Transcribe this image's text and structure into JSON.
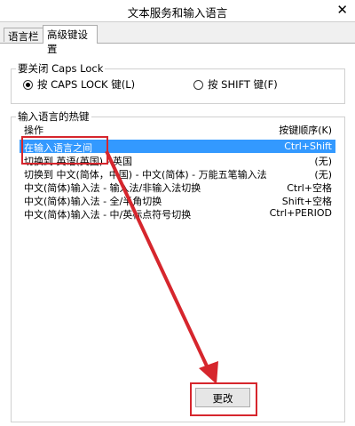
{
  "window": {
    "title": "文本服务和输入语言",
    "close_glyph": "✕"
  },
  "tabs": [
    {
      "label": "语言栏"
    },
    {
      "label": "高级键设置"
    }
  ],
  "caps_lock": {
    "legend": "要关闭 Caps Lock",
    "options": [
      {
        "label": "按 CAPS LOCK 键(L)",
        "selected": true
      },
      {
        "label": "按 SHIFT 键(F)",
        "selected": false
      }
    ]
  },
  "hotkeys": {
    "legend": "输入语言的热键",
    "columns": {
      "action": "操作",
      "key": "按键顺序(K)"
    },
    "rows": [
      {
        "action": "在输入语言之间",
        "key": "Ctrl+Shift",
        "selected": true
      },
      {
        "action": "切换到 英语(英国) - 英国",
        "key": "(无)"
      },
      {
        "action": "切换到 中文(简体，中国) - 中文(简体) - 万能五笔输入法",
        "key": "(无)"
      },
      {
        "action": "中文(简体)输入法 - 输入法/非输入法切换",
        "key": "Ctrl+空格"
      },
      {
        "action": "中文(简体)输入法 - 全/半角切换",
        "key": "Shift+空格"
      },
      {
        "action": "中文(简体)输入法 - 中/英标点符号切换",
        "key": "Ctrl+PERIOD"
      }
    ]
  },
  "change_button": {
    "label": "更改"
  },
  "colors": {
    "annotation_red": "#d6262d",
    "selection_blue": "#3399ff"
  }
}
